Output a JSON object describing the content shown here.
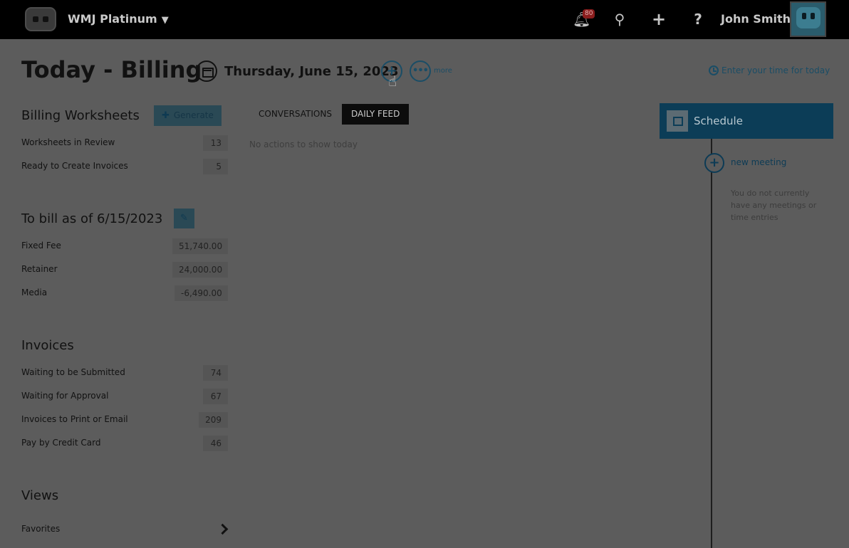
{
  "topbar": {
    "org_name": "WMJ Platinum",
    "notification_count": "80",
    "user_name": "John Smith",
    "icons": [
      "robot-logo-icon",
      "chevron-down-icon",
      "bell-icon",
      "search-icon",
      "plus-icon",
      "help-icon",
      "avatar"
    ]
  },
  "header": {
    "title": "Today - Billing",
    "date": "Thursday, June 15, 2023",
    "more_label": "more",
    "enter_time_label": "Enter your time for today"
  },
  "billing_worksheets": {
    "title": "Billing Worksheets",
    "generate_label": "Generate",
    "rows": [
      {
        "label": "Worksheets in Review",
        "value": "13"
      },
      {
        "label": "Ready to Create Invoices",
        "value": "5"
      }
    ]
  },
  "to_bill": {
    "title": "To bill as of 6/15/2023",
    "rows": [
      {
        "label": "Fixed Fee",
        "value": "51,740.00"
      },
      {
        "label": "Retainer",
        "value": "24,000.00"
      },
      {
        "label": "Media",
        "value": "-6,490.00"
      }
    ]
  },
  "invoices": {
    "title": "Invoices",
    "rows": [
      {
        "label": "Waiting to be Submitted",
        "value": "74"
      },
      {
        "label": "Waiting for Approval",
        "value": "67"
      },
      {
        "label": "Invoices to Print or Email",
        "value": "209"
      },
      {
        "label": "Pay by Credit Card",
        "value": "46"
      }
    ]
  },
  "views": {
    "title": "Views",
    "rows": [
      {
        "label": "Favorites"
      }
    ]
  },
  "feed": {
    "tabs": [
      {
        "label": "CONVERSATIONS",
        "active": false
      },
      {
        "label": "DAILY FEED",
        "active": true
      }
    ],
    "empty_text": "No actions to show today"
  },
  "schedule": {
    "title": "Schedule",
    "new_meeting_label": "new meeting",
    "empty_text": "You do not currently have any meetings or time entries"
  },
  "colors": {
    "overlay_background": "#5c5c5c",
    "topbar": "#000000",
    "accent_blue": "#0c3d57",
    "badge_red": "#8b1d1d"
  }
}
